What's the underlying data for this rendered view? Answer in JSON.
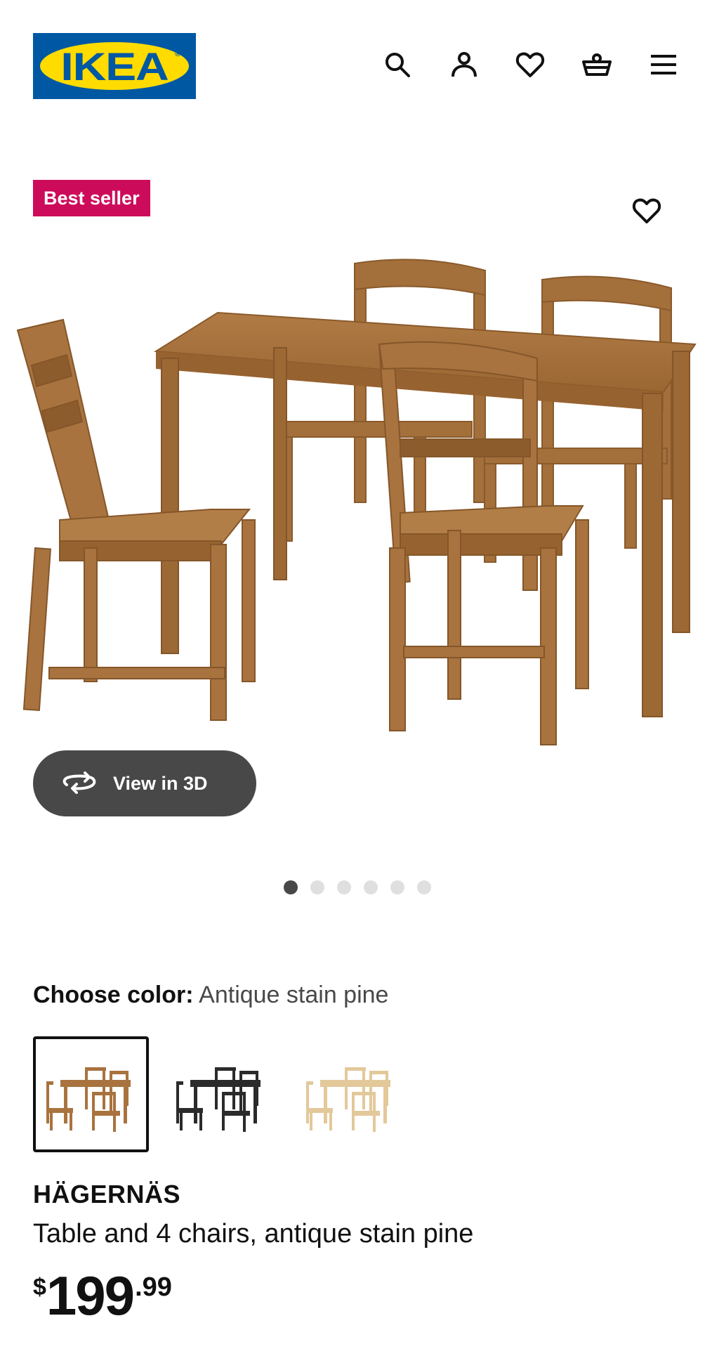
{
  "header": {
    "logo_text": "IKEA",
    "logo_reg": "®",
    "icons": [
      "search-icon",
      "account-icon",
      "favourites-icon",
      "cart-icon",
      "menu-icon"
    ]
  },
  "product": {
    "badge": "Best seller",
    "view_3d_label": "View in 3D",
    "image_count": 6,
    "active_image": 1,
    "choose_color_label": "Choose color:",
    "selected_color": "Antique stain pine",
    "color_options": [
      "Antique stain pine",
      "Black",
      "Natural pine"
    ],
    "name": "HÄGERNÄS",
    "description": "Table and 4 chairs, antique stain pine",
    "price": {
      "currency": "$",
      "integer": "199",
      "decimal": ".99"
    }
  },
  "colors": {
    "brand_blue": "#0058a3",
    "brand_yellow": "#ffdb00",
    "badge": "#cc0c5b",
    "button_dark": "#484848",
    "wood": "#a8733f"
  }
}
